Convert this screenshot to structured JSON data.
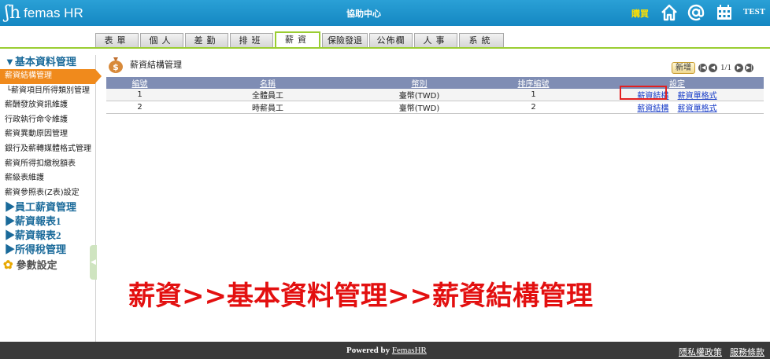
{
  "header": {
    "logo_text": "femas HR",
    "help_center": "協助中心",
    "buy": "購買",
    "user": "TEST",
    "icons": [
      "home-icon",
      "at-icon",
      "calendar-icon"
    ]
  },
  "tabs": [
    "表單",
    "個人",
    "差勤",
    "排班",
    "薪資",
    "保險發退",
    "公佈欄",
    "人事",
    "系統"
  ],
  "active_tab": "薪資",
  "sidebar": {
    "sections": [
      {
        "title": "▼基本資料管理",
        "items": [
          "薪資結構管理",
          "└薪資項目所得類別管理",
          "薪酬發放資訊維護",
          "行政執行命令維護",
          "薪資異動原因管理",
          "銀行及薪轉媒體格式管理",
          "薪資所得扣繳稅額表",
          "薪級表維護",
          "薪資參照表(Z表)設定"
        ]
      }
    ],
    "collapsed": [
      "▶員工薪資管理",
      "▶薪資報表1",
      "▶薪資報表2",
      "▶所得稅管理"
    ],
    "param": "參數設定"
  },
  "main": {
    "title": "薪資結構管理",
    "new_button": "新增",
    "pager": "1/1",
    "table": {
      "headers": [
        "編號",
        "名稱",
        "幣別",
        "排序編號",
        "設定"
      ],
      "rows": [
        {
          "no": "1",
          "name": "全體員工",
          "currency": "臺幣(TWD)",
          "order": "1",
          "links": [
            "薪資結構",
            "薪資單格式"
          ]
        },
        {
          "no": "2",
          "name": "時薪員工",
          "currency": "臺幣(TWD)",
          "order": "2",
          "links": [
            "薪資結構",
            "薪資單格式"
          ]
        }
      ]
    }
  },
  "annotation": "薪資>>基本資料管理>>薪資結構管理",
  "footer": {
    "powered_prefix": "Powered by ",
    "powered_brand": "FemasHR",
    "privacy": "隱私權政策",
    "terms": "服務條款"
  },
  "colors": {
    "header_bg": "#1487c2",
    "active_tab_border": "#9acd32",
    "sidebar_active": "#f08a1c",
    "table_header": "#7f8db4",
    "annotation": "#e31010",
    "footer_bg": "#3a3a3a"
  }
}
